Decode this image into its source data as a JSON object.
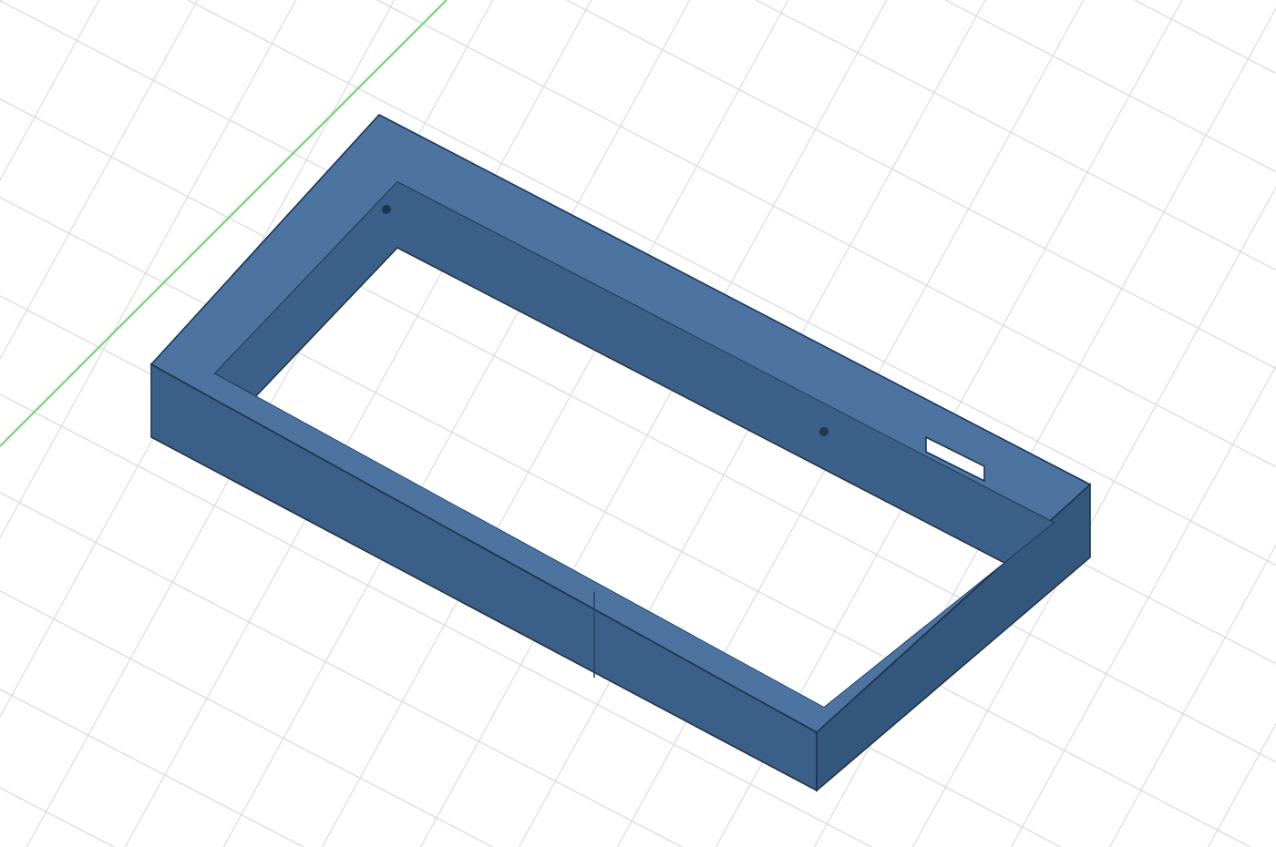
{
  "viewport": {
    "axis_line": true
  }
}
